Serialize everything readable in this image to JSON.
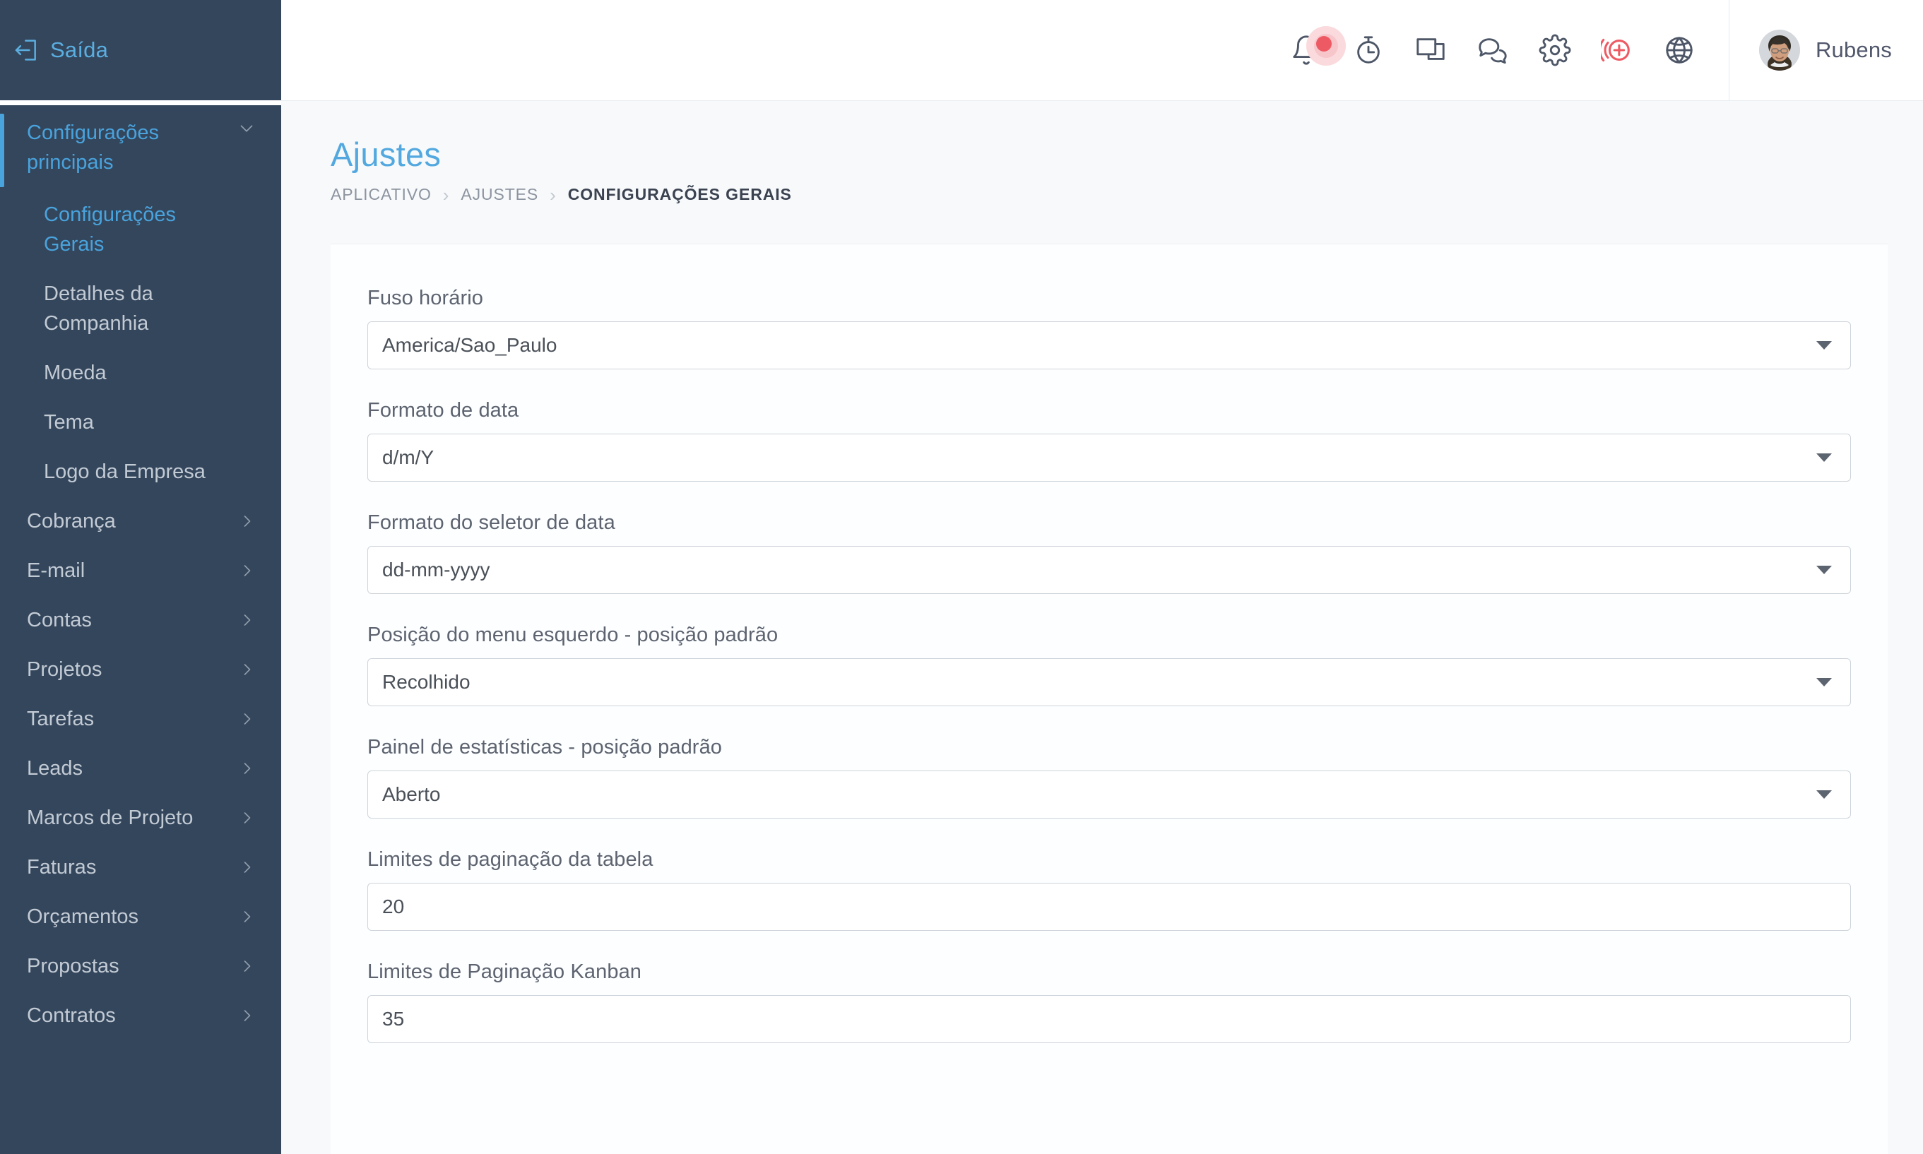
{
  "sidebar": {
    "logout": {
      "label": "Saída",
      "icon": "logout-icon"
    },
    "group": {
      "label": "Configurações principais",
      "icon": "chevron-down-icon",
      "active": true
    },
    "sub_items": [
      {
        "label": "Configurações Gerais",
        "active": true
      },
      {
        "label": "Detalhes da Companhia",
        "active": false
      },
      {
        "label": "Moeda",
        "active": false
      },
      {
        "label": "Tema",
        "active": false
      },
      {
        "label": "Logo da Empresa",
        "active": false
      }
    ],
    "items": [
      {
        "label": "Cobrança",
        "icon": "chevron-right-icon"
      },
      {
        "label": "E-mail",
        "icon": "chevron-right-icon"
      },
      {
        "label": "Contas",
        "icon": "chevron-right-icon"
      },
      {
        "label": "Projetos",
        "icon": "chevron-right-icon"
      },
      {
        "label": "Tarefas",
        "icon": "chevron-right-icon"
      },
      {
        "label": "Leads",
        "icon": "chevron-right-icon"
      },
      {
        "label": "Marcos de Projeto",
        "icon": "chevron-right-icon"
      },
      {
        "label": "Faturas",
        "icon": "chevron-right-icon"
      },
      {
        "label": "Orçamentos",
        "icon": "chevron-right-icon"
      },
      {
        "label": "Propostas",
        "icon": "chevron-right-icon"
      },
      {
        "label": "Contratos",
        "icon": "chevron-right-icon"
      }
    ]
  },
  "topbar": {
    "icons": [
      {
        "name": "notifications-bell-icon",
        "has_badge": true
      },
      {
        "name": "timer-clock-icon",
        "has_badge": false
      },
      {
        "name": "windows-screens-icon",
        "has_badge": false
      },
      {
        "name": "chat-bubbles-icon",
        "has_badge": false
      },
      {
        "name": "gear-settings-icon",
        "has_badge": false
      },
      {
        "name": "add-circle-icon",
        "has_badge": false
      },
      {
        "name": "globe-language-icon",
        "has_badge": false
      }
    ],
    "user": {
      "name": "Rubens",
      "avatar": "user-avatar"
    }
  },
  "page": {
    "title": "Ajustes",
    "breadcrumb": [
      {
        "label": "APLICATIVO",
        "current": false
      },
      {
        "label": "AJUSTES",
        "current": false
      },
      {
        "label": "CONFIGURAÇÕES GERAIS",
        "current": true
      }
    ],
    "breadcrumb_separator": "›"
  },
  "form": {
    "fields": [
      {
        "label": "Fuso horário",
        "value": "America/Sao_Paulo",
        "type": "select"
      },
      {
        "label": "Formato de data",
        "value": "d/m/Y",
        "type": "select"
      },
      {
        "label": "Formato do seletor de data",
        "value": "dd-mm-yyyy",
        "type": "select"
      },
      {
        "label": "Posição do menu esquerdo - posição padrão",
        "value": "Recolhido",
        "type": "select"
      },
      {
        "label": "Painel de estatísticas - posição padrão",
        "value": "Aberto",
        "type": "select"
      },
      {
        "label": "Limites de paginação da tabela",
        "value": "20",
        "type": "text"
      },
      {
        "label": "Limites de Paginação Kanban",
        "value": "35",
        "type": "text"
      }
    ]
  },
  "colors": {
    "sidebar_bg": "#34465c",
    "accent_blue": "#49a3dd",
    "accent_red": "#ee5a64",
    "page_bg": "#f7f9fb",
    "text_muted": "#8c949f"
  }
}
